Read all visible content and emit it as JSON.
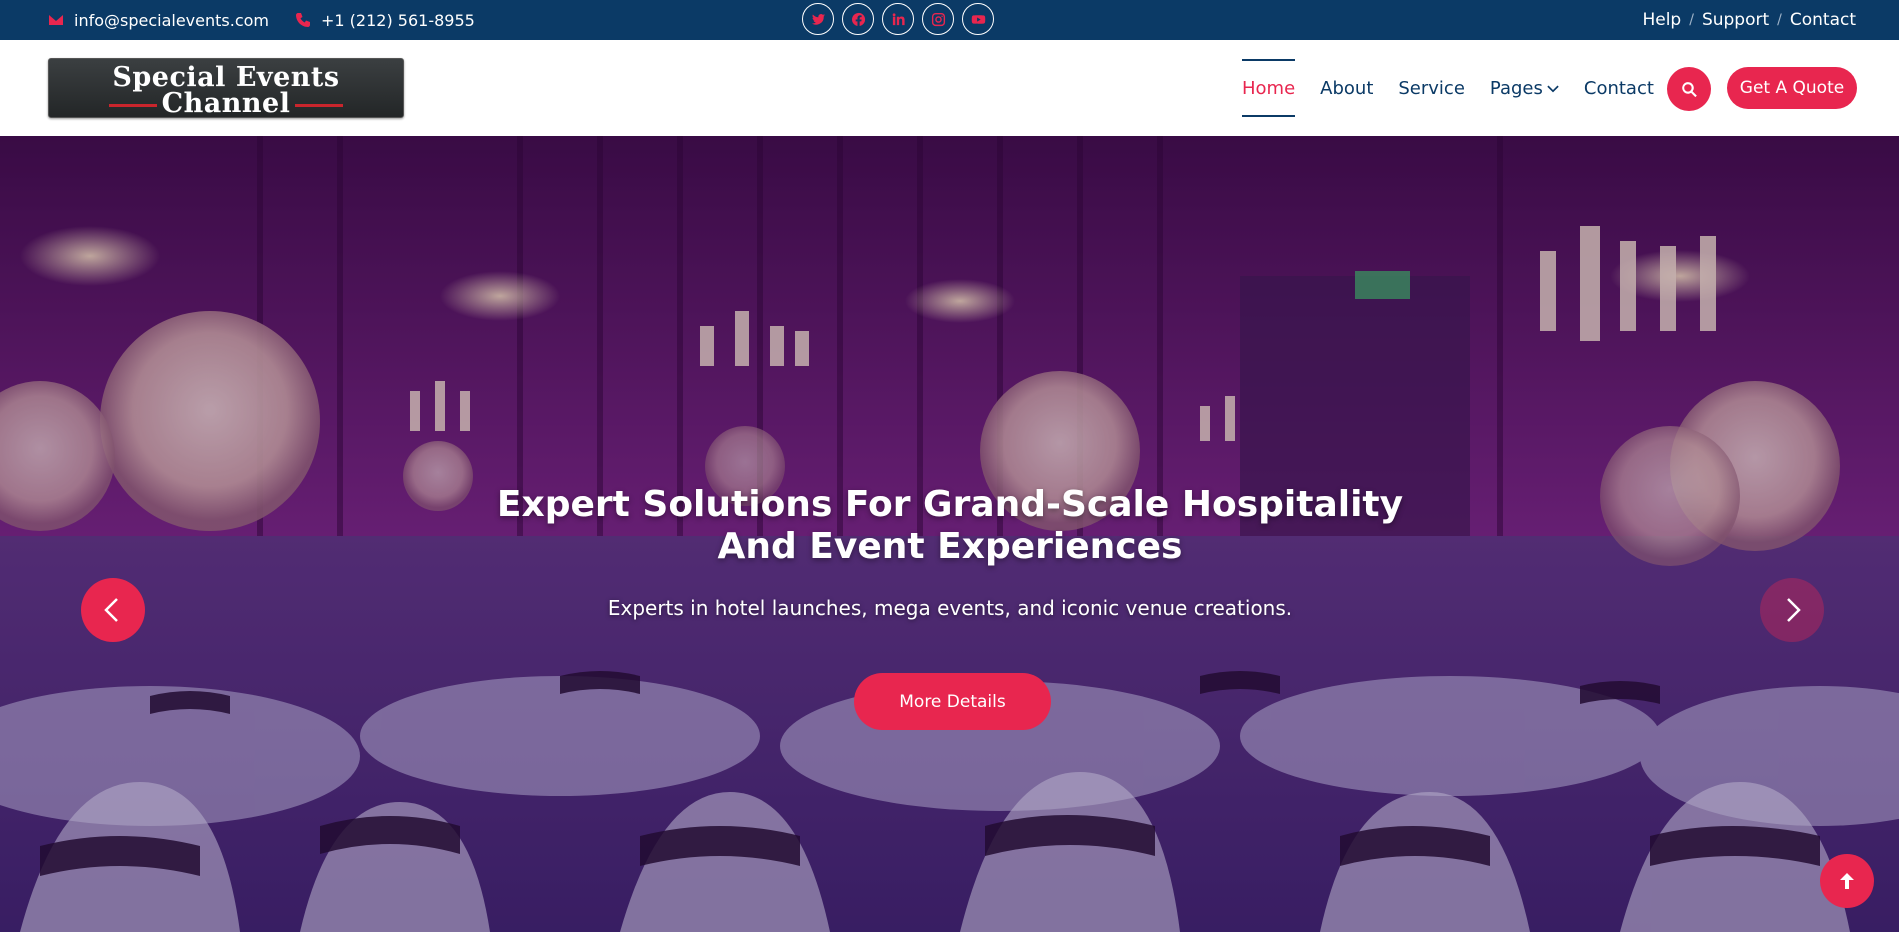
{
  "topbar": {
    "email": "info@specialevents.com",
    "phone": "+1 (212) 561-8955",
    "social": [
      "twitter-icon",
      "facebook-icon",
      "linkedin-icon",
      "instagram-icon",
      "youtube-icon"
    ],
    "links": [
      "Help",
      "Support",
      "Contact"
    ]
  },
  "header": {
    "logo": {
      "line1": "Special Events",
      "line2": "Channel"
    },
    "nav": [
      {
        "label": "Home",
        "active": true
      },
      {
        "label": "About"
      },
      {
        "label": "Service"
      },
      {
        "label": "Pages",
        "dropdown": true
      },
      {
        "label": "Contact"
      }
    ],
    "quote_button": "Get A Quote"
  },
  "hero": {
    "title_line1": "Expert Solutions For Grand-Scale Hospitality",
    "title_line2": "And Event Experiences",
    "subtitle": "Experts in hotel launches, mega events, and iconic venue creations.",
    "button": "More Details"
  },
  "colors": {
    "topbar_bg": "#0b3a66",
    "accent": "#e8264f",
    "nav_text": "#0b3a66"
  }
}
